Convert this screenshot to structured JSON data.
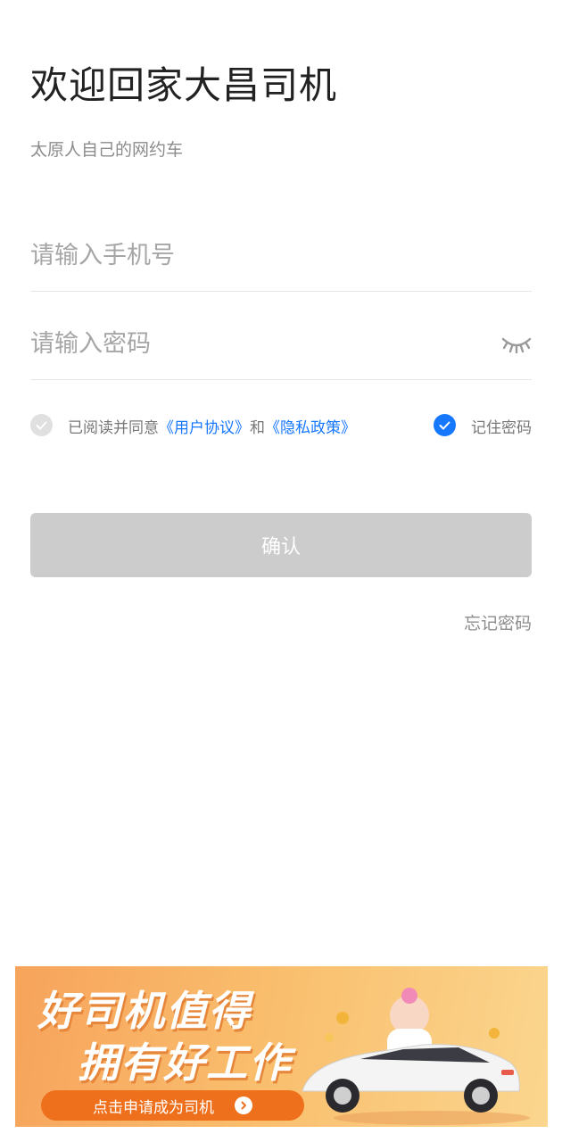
{
  "header": {
    "title": "欢迎回家大昌司机",
    "subtitle": "太原人自己的网约车"
  },
  "form": {
    "phone_placeholder": "请输入手机号",
    "password_placeholder": "请输入密码",
    "password_toggle_icon": "eye-closed-icon"
  },
  "agreement": {
    "prefix": "已阅读并同意",
    "user_agreement": "《用户协议》",
    "and": "和",
    "privacy_policy": "《隐私政策》",
    "agreed": false,
    "remember_label": "记住密码",
    "remember_checked": true
  },
  "actions": {
    "confirm_label": "确认",
    "forgot_label": "忘记密码"
  },
  "banner": {
    "line1": "好司机值得",
    "line2": "拥有好工作",
    "cta": "点击申请成为司机"
  },
  "colors": {
    "accent": "#1677ff",
    "button_disabled": "#cccccc",
    "banner_cta": "#ee6f1c"
  }
}
